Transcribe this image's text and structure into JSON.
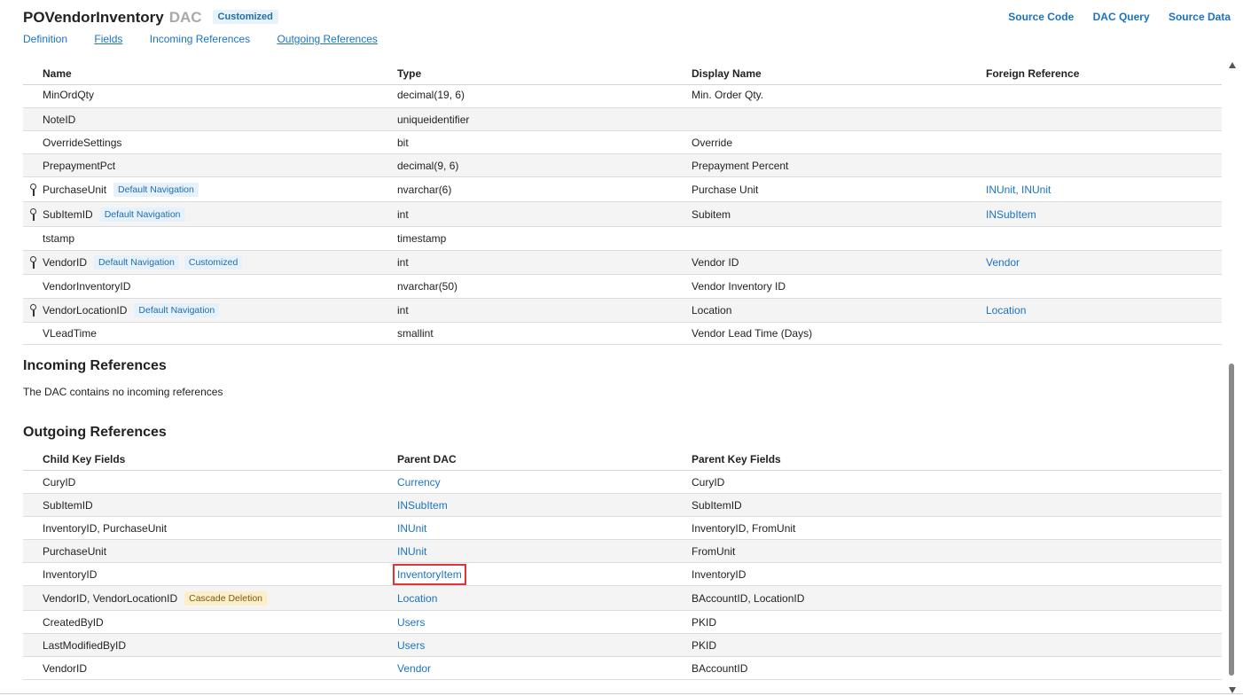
{
  "header": {
    "title": "POVendorInventory",
    "dac_label": "DAC",
    "badge": "Customized",
    "links": [
      "Source Code",
      "DAC Query",
      "Source Data"
    ],
    "tabs": [
      "Definition",
      "Fields",
      "Incoming References",
      "Outgoing References"
    ]
  },
  "fields_table": {
    "columns": [
      "Name",
      "Type",
      "Display Name",
      "Foreign Reference"
    ],
    "rows": [
      {
        "name": "MinOrdQty",
        "type": "decimal(19, 6)",
        "display": "Min. Order Qty.",
        "foreign": "",
        "key": false,
        "tags": []
      },
      {
        "name": "NoteID",
        "type": "uniqueidentifier",
        "display": "",
        "foreign": "",
        "key": false,
        "tags": []
      },
      {
        "name": "OverrideSettings",
        "type": "bit",
        "display": "Override",
        "foreign": "",
        "key": false,
        "tags": []
      },
      {
        "name": "PrepaymentPct",
        "type": "decimal(9, 6)",
        "display": "Prepayment Percent",
        "foreign": "",
        "key": false,
        "tags": []
      },
      {
        "name": "PurchaseUnit",
        "type": "nvarchar(6)",
        "display": "Purchase Unit",
        "foreign": "INUnit, INUnit",
        "key": true,
        "tags": [
          "Default Navigation"
        ]
      },
      {
        "name": "SubItemID",
        "type": "int",
        "display": "Subitem",
        "foreign": "INSubItem",
        "key": true,
        "tags": [
          "Default Navigation"
        ]
      },
      {
        "name": "tstamp",
        "type": "timestamp",
        "display": "",
        "foreign": "",
        "key": false,
        "tags": []
      },
      {
        "name": "VendorID",
        "type": "int",
        "display": "Vendor ID",
        "foreign": "Vendor",
        "key": true,
        "tags": [
          "Default Navigation",
          "Customized"
        ]
      },
      {
        "name": "VendorInventoryID",
        "type": "nvarchar(50)",
        "display": "Vendor Inventory ID",
        "foreign": "",
        "key": false,
        "tags": []
      },
      {
        "name": "VendorLocationID",
        "type": "int",
        "display": "Location",
        "foreign": "Location",
        "key": true,
        "tags": [
          "Default Navigation"
        ]
      },
      {
        "name": "VLeadTime",
        "type": "smallint",
        "display": "Vendor Lead Time (Days)",
        "foreign": "",
        "key": false,
        "tags": []
      }
    ]
  },
  "incoming": {
    "title": "Incoming References",
    "text": "The DAC contains no incoming references"
  },
  "outgoing": {
    "title": "Outgoing References",
    "columns": [
      "Child Key Fields",
      "Parent DAC",
      "Parent Key Fields"
    ],
    "rows": [
      {
        "child": "CuryID",
        "parent": "Currency",
        "parent_keys": "CuryID",
        "tag": "",
        "highlight": false
      },
      {
        "child": "SubItemID",
        "parent": "INSubItem",
        "parent_keys": "SubItemID",
        "tag": "",
        "highlight": false
      },
      {
        "child": "InventoryID, PurchaseUnit",
        "parent": "INUnit",
        "parent_keys": "InventoryID, FromUnit",
        "tag": "",
        "highlight": false
      },
      {
        "child": "PurchaseUnit",
        "parent": "INUnit",
        "parent_keys": "FromUnit",
        "tag": "",
        "highlight": false
      },
      {
        "child": "InventoryID",
        "parent": "InventoryItem",
        "parent_keys": "InventoryID",
        "tag": "",
        "highlight": true
      },
      {
        "child": "VendorID, VendorLocationID",
        "parent": "Location",
        "parent_keys": "BAccountID, LocationID",
        "tag": "Cascade Deletion",
        "highlight": false
      },
      {
        "child": "CreatedByID",
        "parent": "Users",
        "parent_keys": "PKID",
        "tag": "",
        "highlight": false
      },
      {
        "child": "LastModifiedByID",
        "parent": "Users",
        "parent_keys": "PKID",
        "tag": "",
        "highlight": false
      },
      {
        "child": "VendorID",
        "parent": "Vendor",
        "parent_keys": "BAccountID",
        "tag": "",
        "highlight": false
      }
    ]
  },
  "colors": {
    "link": "#1a73c2",
    "highlight": "#e0343a",
    "cascade_bg": "#fbeec8"
  }
}
